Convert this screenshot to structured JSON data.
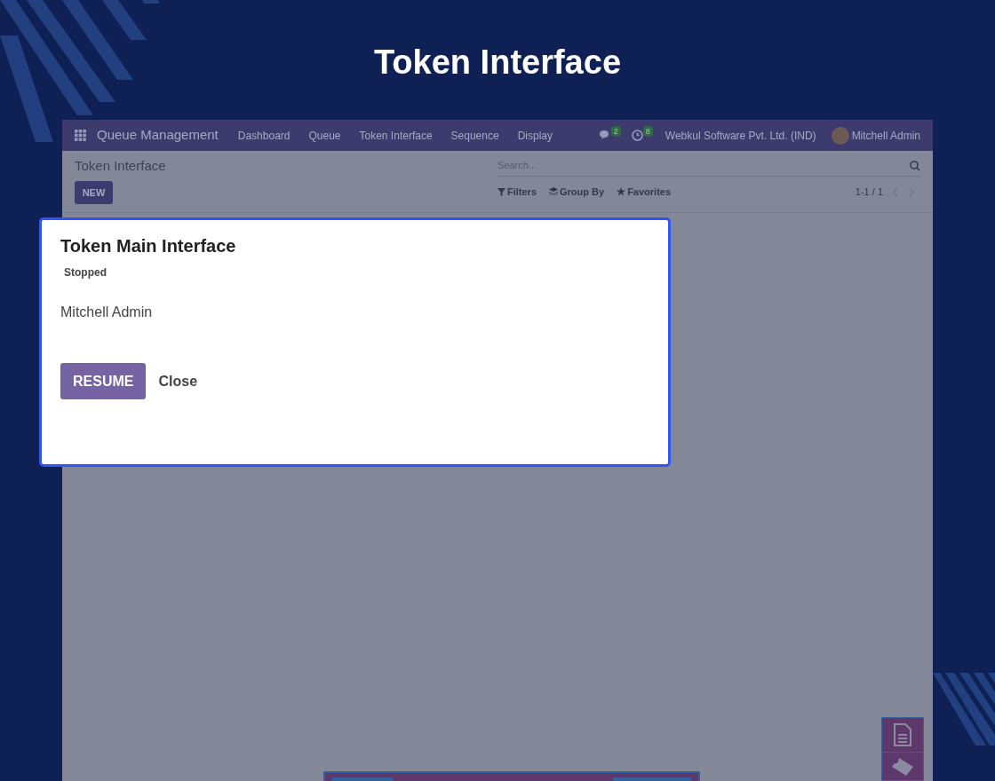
{
  "page_title": "Token Interface",
  "navbar": {
    "app_name": "Queue Management",
    "menu": [
      "Dashboard",
      "Queue",
      "Token Interface",
      "Sequence",
      "Display"
    ],
    "messages_count": "2",
    "activities_count": "8",
    "company": "Webkul Software Pvt. Ltd. (IND)",
    "user": "Mitchell Admin"
  },
  "control_panel": {
    "breadcrumb": "Token Interface",
    "new_button": "NEW",
    "search": {
      "placeholder": "Search..."
    },
    "filters": "Filters",
    "group_by": "Group By",
    "favorites": "Favorites",
    "pager": "1-1 / 1"
  },
  "dialog": {
    "title": "Token Main Interface",
    "status": "Stopped",
    "user": "Mitchell Admin",
    "buttons": [
      {
        "label": "RESUME",
        "kind": "primary"
      },
      {
        "label": "Close",
        "kind": "link"
      }
    ]
  }
}
